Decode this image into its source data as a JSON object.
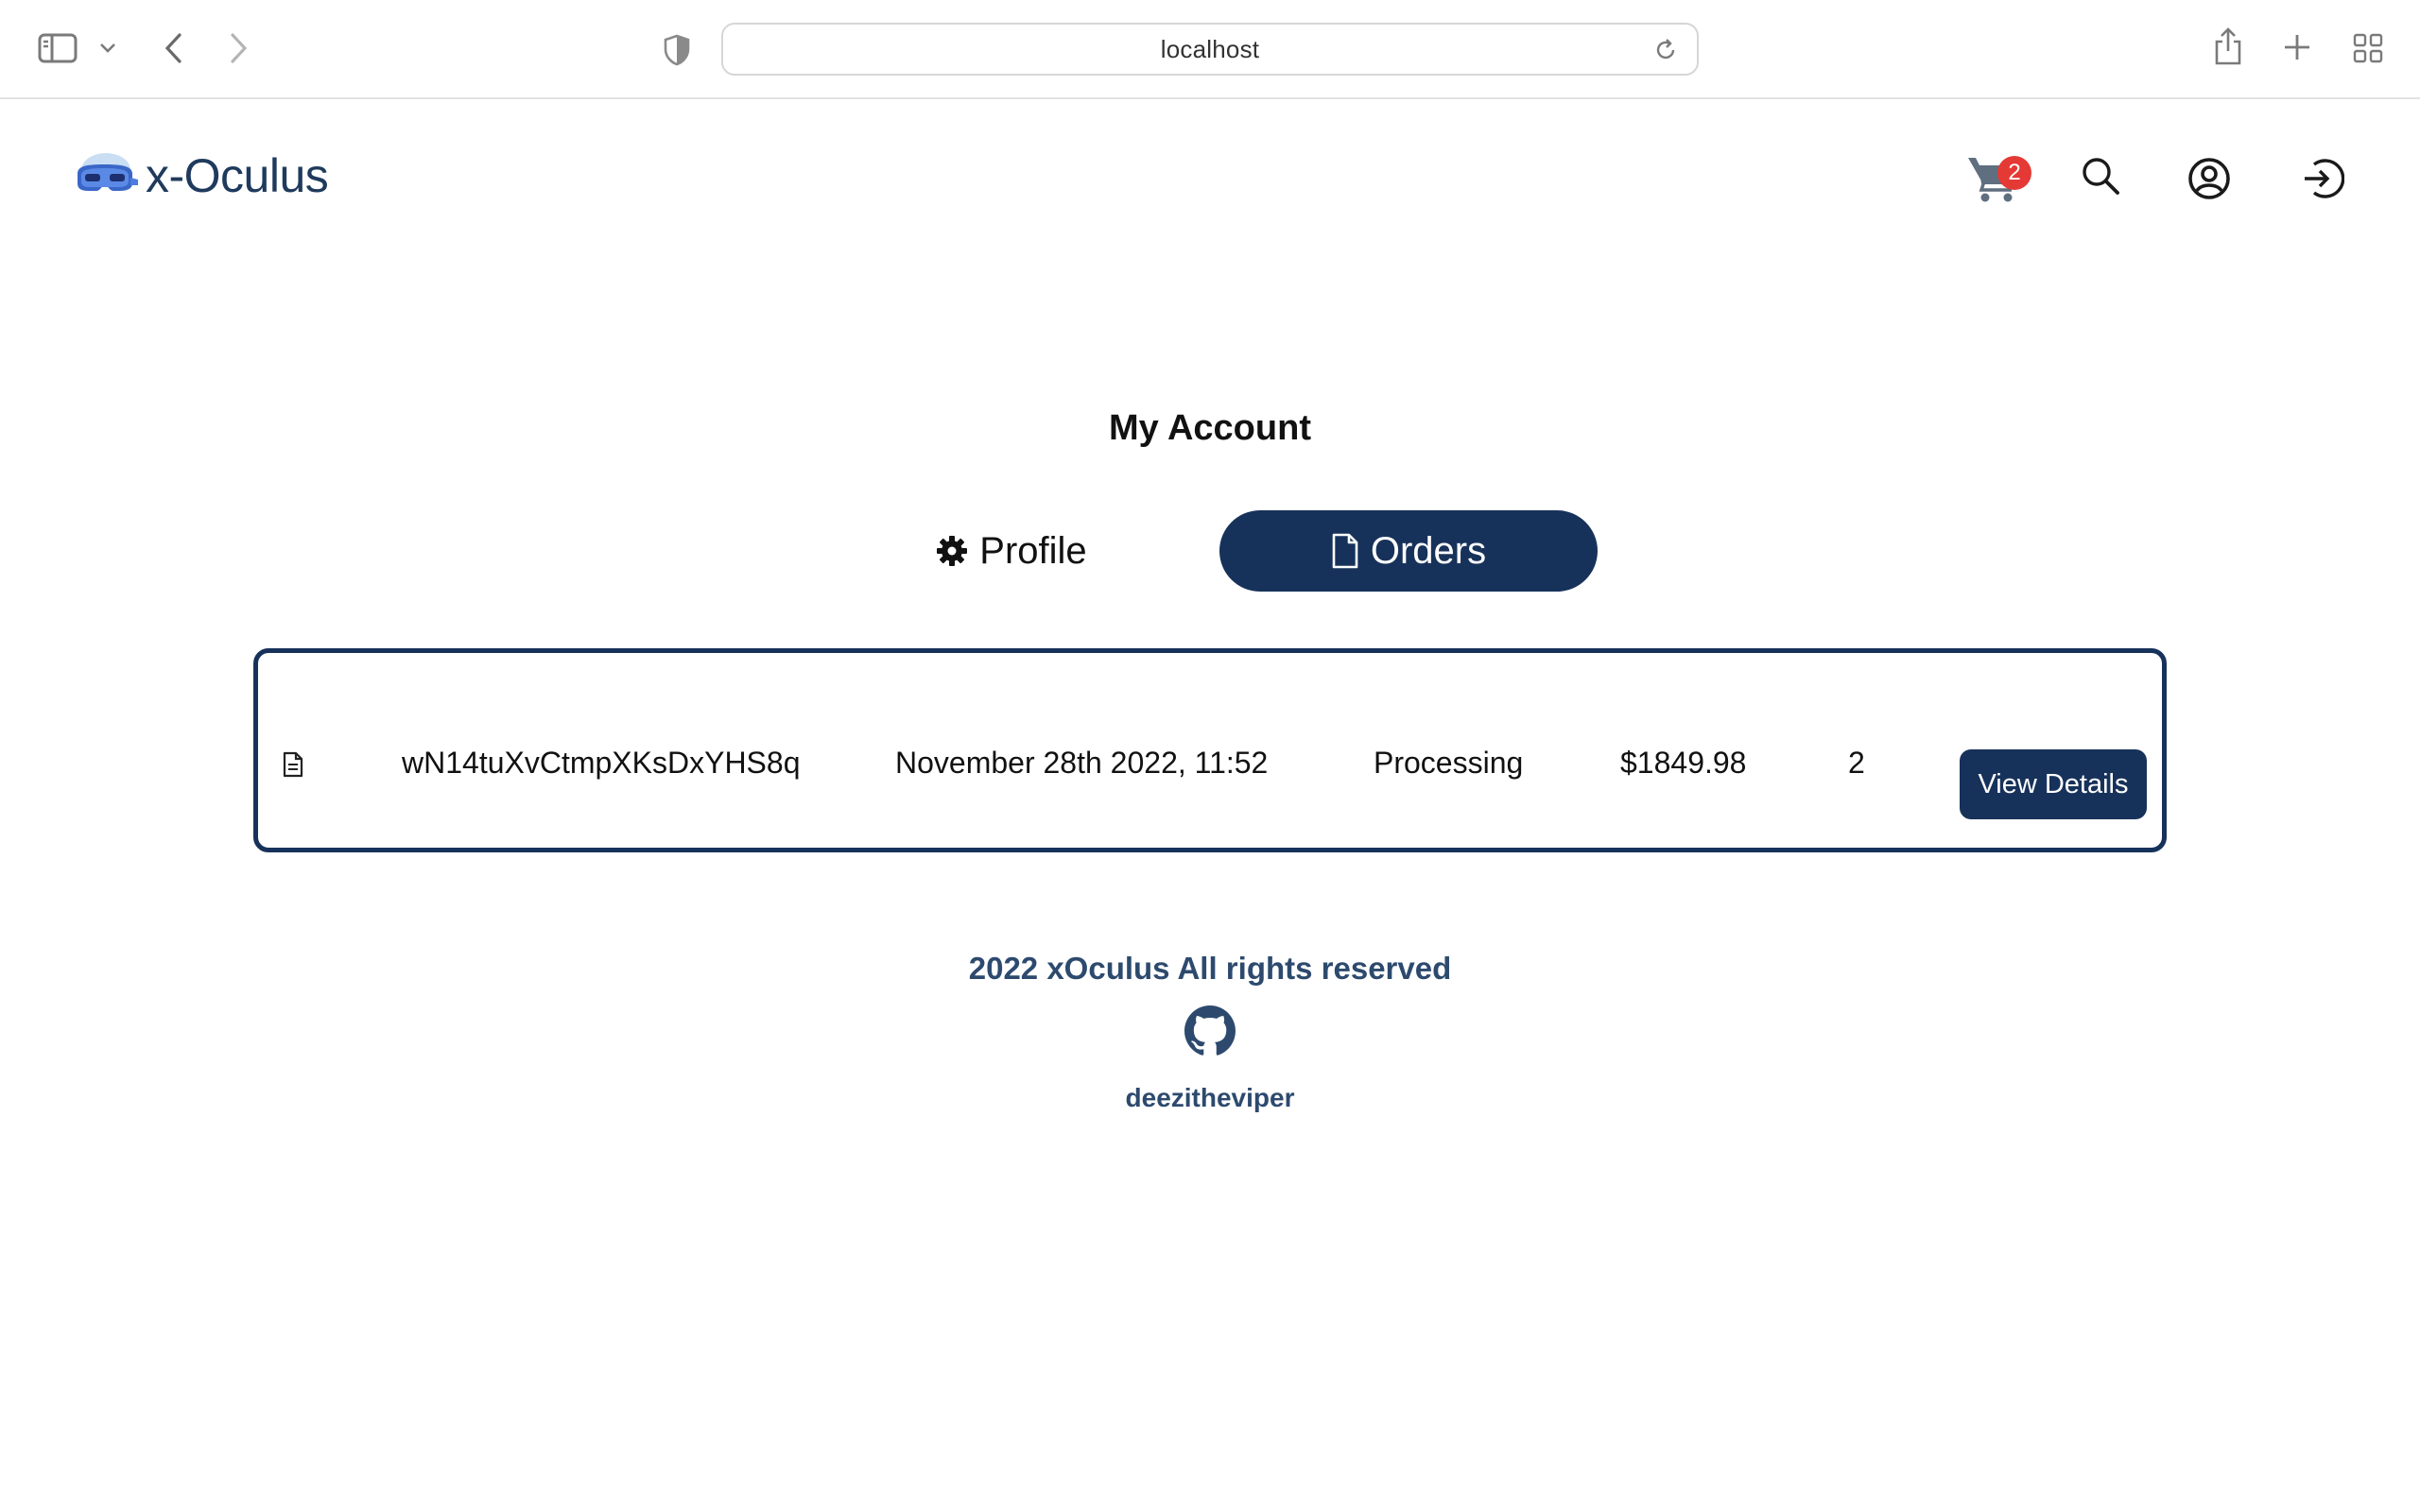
{
  "browser": {
    "url": "localhost",
    "icons": [
      "sidebar-icon",
      "chevron-down-icon",
      "back-icon",
      "forward-icon",
      "shield-icon",
      "reload-icon",
      "share-icon",
      "new-tab-icon",
      "tab-overview-icon"
    ]
  },
  "header": {
    "brand": "x-Oculus",
    "cart_count": "2",
    "icons": [
      "cart-icon",
      "search-icon",
      "user-icon",
      "logout-icon"
    ]
  },
  "main": {
    "title": "My Account",
    "tabs": [
      {
        "label": "Profile",
        "icon": "gear-icon",
        "active": false
      },
      {
        "label": "Orders",
        "icon": "document-icon",
        "active": true
      }
    ],
    "orders": [
      {
        "id": "wN14tuXvCtmpXKsDxYHS8q",
        "date": "November 28th 2022, 11:52",
        "status": "Processing",
        "total": "$1849.98",
        "quantity": "2",
        "action_label": "View Details"
      }
    ]
  },
  "footer": {
    "copyright": "2022 xOculus All rights reserved",
    "github_user": "deezitheviper"
  },
  "colors": {
    "primary": "#17325a",
    "brand_text": "#1f3a5c",
    "footer_text": "#2d4a6e",
    "badge": "#e53935"
  }
}
